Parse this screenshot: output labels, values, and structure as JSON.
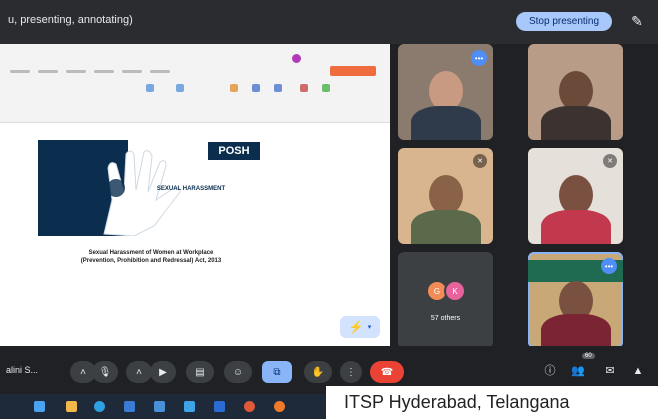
{
  "banner": {
    "presenting_text": "u, presenting, annotating)",
    "stop_label": "Stop presenting"
  },
  "slide": {
    "posh_label": "POSH",
    "book_title": "SEXUAL HARASSMENT",
    "caption_line1": "Sexual Harassment of Women at Workplace",
    "caption_line2": "(Prevention, Prohibition and Redressal) Act, 2013"
  },
  "participants": [
    {
      "name": "",
      "badge": "blue-dots"
    },
    {
      "name": "",
      "badge": "none"
    },
    {
      "name": "",
      "badge": "muted"
    },
    {
      "name": "",
      "badge": "muted"
    }
  ],
  "others": {
    "label": "57 others",
    "avatars": [
      {
        "letter": "G",
        "color": "#f28b55"
      },
      {
        "letter": "K",
        "color": "#e8639e"
      }
    ]
  },
  "active_speaker": {
    "name": ""
  },
  "controls": {
    "self_name": "alini S..."
  },
  "watermark": "ITSP Hyderabad, Telangana"
}
